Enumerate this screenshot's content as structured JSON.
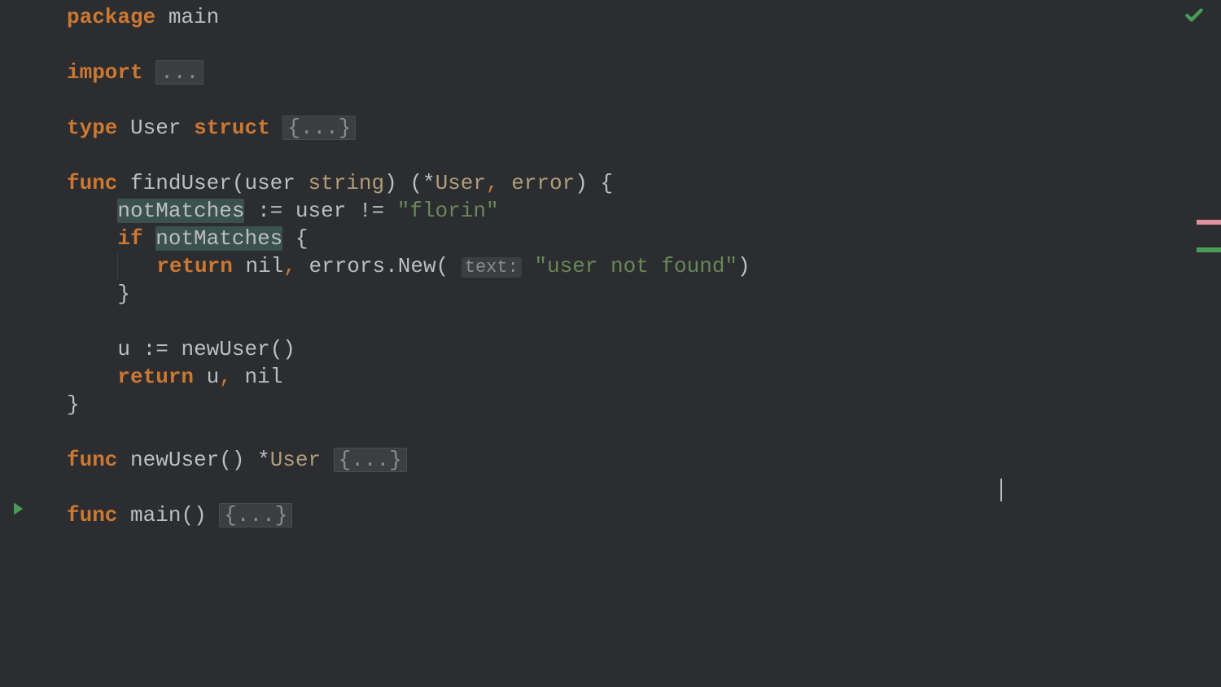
{
  "kw": {
    "package": "package",
    "import": "import",
    "type": "type",
    "struct": "struct",
    "func": "func",
    "if": "if",
    "return": "return"
  },
  "id": {
    "main": "main",
    "User": "User",
    "findUser": "findUser",
    "user": "user",
    "string": "string",
    "error": "error",
    "notMatches": "notMatches",
    "nil": "nil",
    "errors": "errors",
    "New": "New",
    "u": "u",
    "newUser": "newUser",
    "mainFn": "main"
  },
  "str": {
    "florin": "\"florin\"",
    "notFound": "\"user not found\""
  },
  "hint": {
    "text": "text:"
  },
  "fold": {
    "dots": "...",
    "bracesDots": "{...}"
  },
  "punc": {
    "lparen": "(",
    "rparen": ")",
    "lbrace": "{",
    "rbrace": "}",
    "star": "*",
    "comma": ",",
    "colonEq": ":=",
    "neq": "!=",
    "dot": "."
  },
  "colors": {
    "markerPink": "#c75450",
    "markerGreen": "#499c54"
  }
}
